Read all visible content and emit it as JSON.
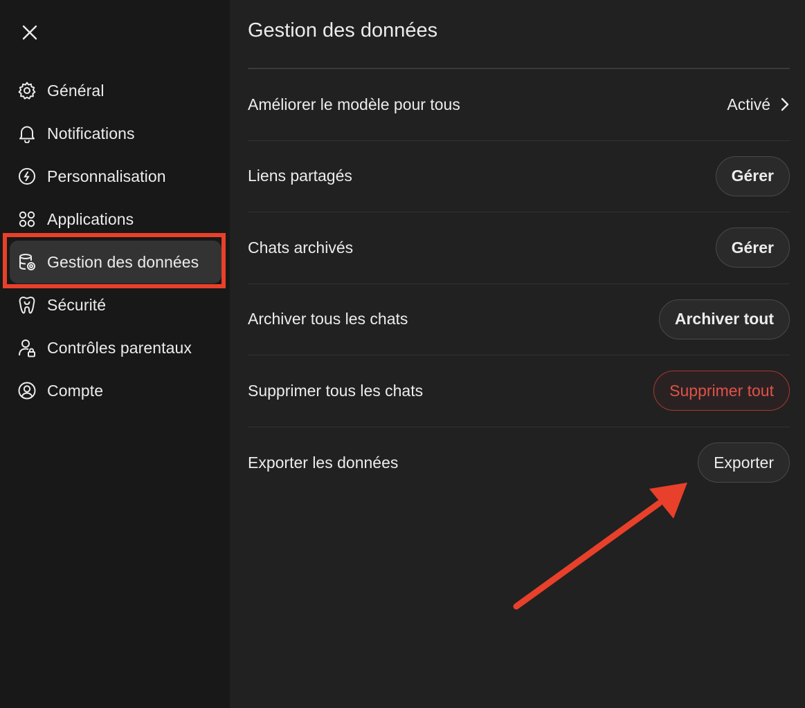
{
  "sidebar": {
    "close_icon": "close-icon",
    "items": [
      {
        "label": "Général",
        "icon": "gear-icon"
      },
      {
        "label": "Notifications",
        "icon": "bell-icon"
      },
      {
        "label": "Personnalisation",
        "icon": "personalization-icon"
      },
      {
        "label": "Applications",
        "icon": "apps-grid-icon"
      },
      {
        "label": "Gestion des données",
        "icon": "database-gear-icon",
        "active": true
      },
      {
        "label": "Sécurité",
        "icon": "security-icon"
      },
      {
        "label": "Contrôles parentaux",
        "icon": "user-lock-icon"
      },
      {
        "label": "Compte",
        "icon": "account-icon"
      }
    ]
  },
  "main": {
    "title": "Gestion des données",
    "rows": [
      {
        "label": "Améliorer le modèle pour tous",
        "value": "Activé"
      },
      {
        "label": "Liens partagés",
        "button": "Gérer"
      },
      {
        "label": "Chats archivés",
        "button": "Gérer"
      },
      {
        "label": "Archiver tous les chats",
        "button": "Archiver tout"
      },
      {
        "label": "Supprimer tous les chats",
        "button": "Supprimer tout"
      },
      {
        "label": "Exporter les données",
        "button": "Exporter"
      }
    ]
  },
  "colors": {
    "background": "#212121",
    "sidebar_bg": "#181818",
    "active_item_bg": "#333333",
    "annotation_red": "#e8402a",
    "danger_text": "#e0524a"
  }
}
